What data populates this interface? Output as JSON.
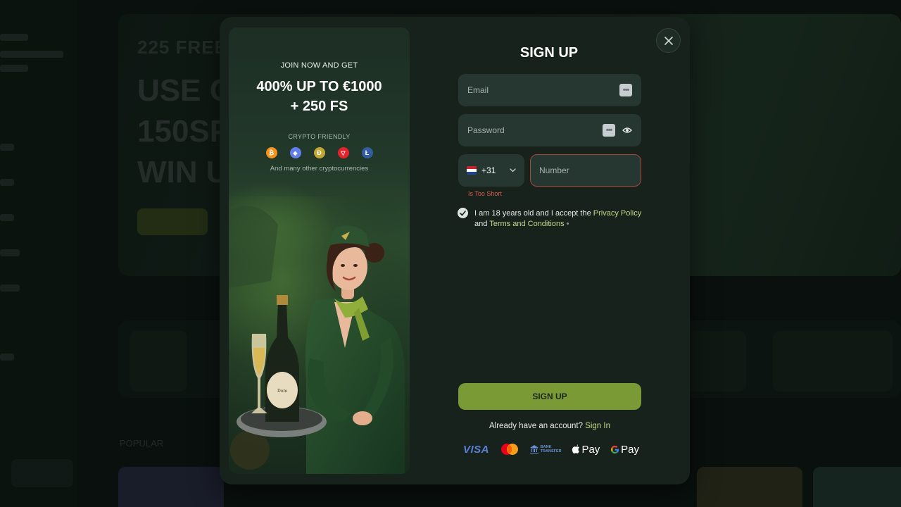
{
  "background": {
    "hero_subtitle": "225 FREE",
    "hero_title_lines": [
      "USE C",
      "150SP",
      "WIN U"
    ],
    "section_popular": "POPULAR"
  },
  "promo": {
    "join_text": "JOIN NOW AND GET",
    "offer_line1": "400% UP TO €1000",
    "offer_line2": "+ 250 FS",
    "crypto_label": "CRYPTO FRIENDLY",
    "coins": [
      {
        "name": "bitcoin-icon",
        "glyph": "₿",
        "color": "#f7931a"
      },
      {
        "name": "ethereum-icon",
        "glyph": "◆",
        "color": "#627eea"
      },
      {
        "name": "dogecoin-icon",
        "glyph": "Ð",
        "color": "#c2a633"
      },
      {
        "name": "tron-icon",
        "glyph": "▽",
        "color": "#e5232f"
      },
      {
        "name": "litecoin-icon",
        "glyph": "Ł",
        "color": "#345d9d"
      }
    ],
    "more_crypto": "And many other cryptocurrencies"
  },
  "form": {
    "title": "SIGN UP",
    "email_placeholder": "Email",
    "password_placeholder": "Password",
    "phone_code": "+31",
    "number_placeholder": "Number",
    "number_error": "Is Too Short",
    "terms_prefix": "I am 18 years old and I accept the ",
    "privacy_link": "Privacy Policy",
    "terms_and": "and ",
    "terms_link": "Terms and Conditions",
    "terms_required": " •",
    "terms_checked": true,
    "submit_label": "SIGN UP",
    "have_account": "Already have an account?",
    "signin_link": "Sign In"
  },
  "payments": {
    "visa": "VISA",
    "bank_line1": "BANK",
    "bank_line2": "TRANSFER",
    "applepay": "Pay",
    "gpay": "Pay"
  },
  "colors": {
    "accent": "#7a9a36",
    "link": "#c6d88a",
    "error": "#e05a44"
  }
}
